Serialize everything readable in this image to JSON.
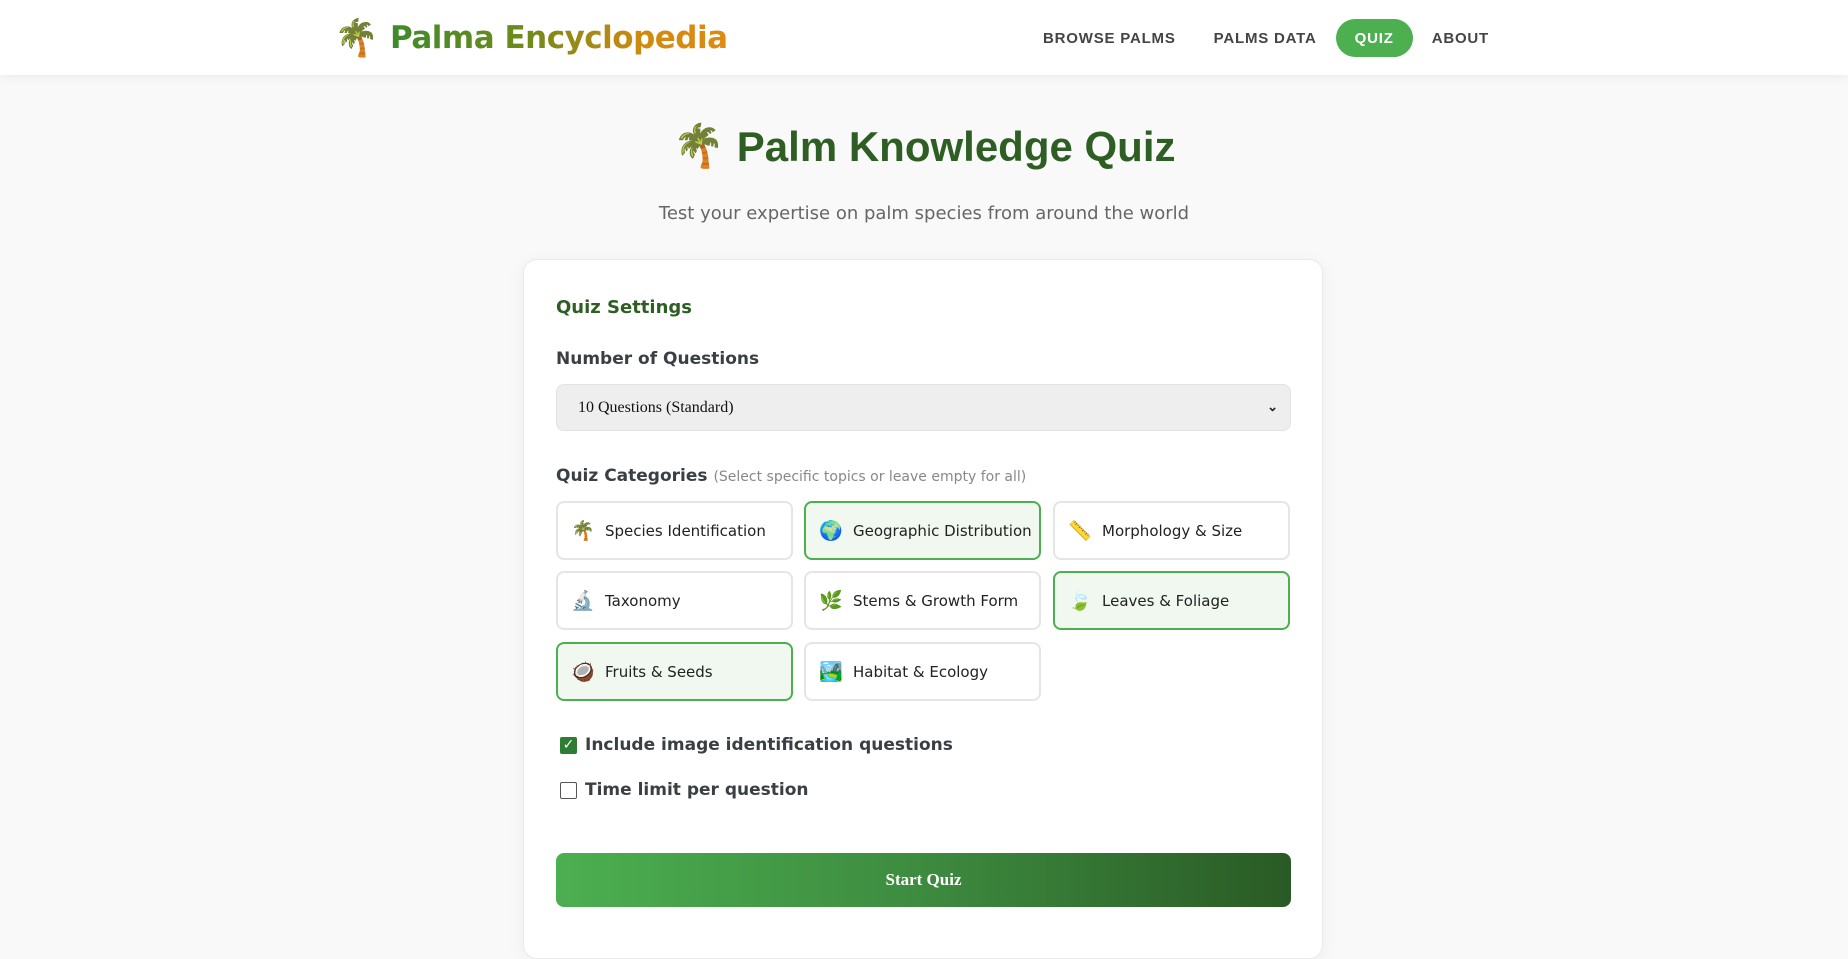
{
  "brand": {
    "icon": "palm-tree-icon",
    "icon_glyph": "🌴",
    "name": "Palma Encyclopedia"
  },
  "nav": {
    "items": [
      {
        "label": "BROWSE PALMS",
        "active": false
      },
      {
        "label": "PALMS DATA",
        "active": false
      },
      {
        "label": "QUIZ",
        "active": true
      },
      {
        "label": "ABOUT",
        "active": false
      }
    ]
  },
  "header": {
    "title_icon": "🌴",
    "title": "Palm Knowledge Quiz",
    "subtitle": "Test your expertise on palm species from around the world"
  },
  "settings": {
    "title": "Quiz Settings",
    "num_questions_label": "Number of Questions",
    "num_questions_value": "10 Questions (Standard)",
    "categories_label": "Quiz Categories",
    "categories_hint": "(Select specific topics or leave empty for all)",
    "categories": [
      {
        "label": "Species Identification",
        "icon": "🌴",
        "icon_name": "palm-tree-icon",
        "selected": false
      },
      {
        "label": "Geographic Distribution",
        "icon": "🌍",
        "icon_name": "globe-icon",
        "selected": true
      },
      {
        "label": "Morphology & Size",
        "icon": "📏",
        "icon_name": "ruler-icon",
        "selected": false
      },
      {
        "label": "Taxonomy",
        "icon": "🔬",
        "icon_name": "microscope-icon",
        "selected": false
      },
      {
        "label": "Stems & Growth Form",
        "icon": "🌿",
        "icon_name": "herb-icon",
        "selected": false
      },
      {
        "label": "Leaves & Foliage",
        "icon": "🍃",
        "icon_name": "leaf-icon",
        "selected": true
      },
      {
        "label": "Fruits & Seeds",
        "icon": "🥥",
        "icon_name": "coconut-icon",
        "selected": true
      },
      {
        "label": "Habitat & Ecology",
        "icon": "🏞️",
        "icon_name": "landscape-icon",
        "selected": false
      }
    ],
    "options": [
      {
        "label": "Include image identification questions",
        "checked": true
      },
      {
        "label": "Time limit per question",
        "checked": false
      }
    ],
    "start_label": "Start Quiz"
  },
  "colors": {
    "accent": "#4caf50",
    "title_green": "#2e5e24",
    "selected_bg": "#f0f8f0"
  }
}
